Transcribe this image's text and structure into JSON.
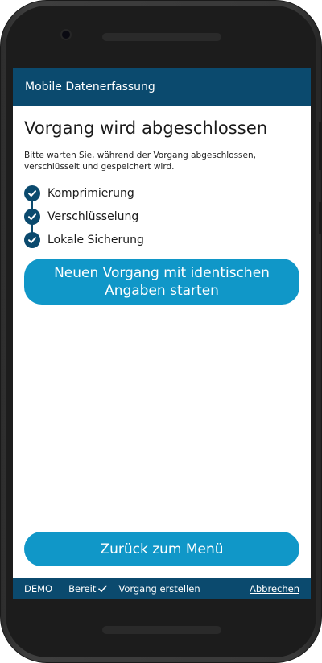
{
  "app": {
    "title": "Mobile Datenerfassung"
  },
  "page": {
    "title": "Vorgang wird abgeschlossen",
    "intro": "Bitte warten Sie, während der Vorgang abgeschlossen, verschlüsselt und gespeichert wird."
  },
  "steps": [
    {
      "label": "Komprimierung",
      "status": "done",
      "icon": "check-icon"
    },
    {
      "label": "Verschlüsselung",
      "status": "done",
      "icon": "check-icon"
    },
    {
      "label": "Lokale Sicherung",
      "status": "done",
      "icon": "check-icon"
    }
  ],
  "buttons": {
    "new_same": "Neuen Vorgang mit identischen Angaben starten",
    "back_menu": "Zurück zum Menü"
  },
  "statusbar": {
    "mode": "DEMO",
    "ready": "Bereit",
    "ready_icon": "check-icon",
    "action": "Vorgang erstellen",
    "cancel": "Abbrechen"
  },
  "colors": {
    "header": "#0b4a6e",
    "button": "#1097c8",
    "check": "#0b4a6e"
  }
}
